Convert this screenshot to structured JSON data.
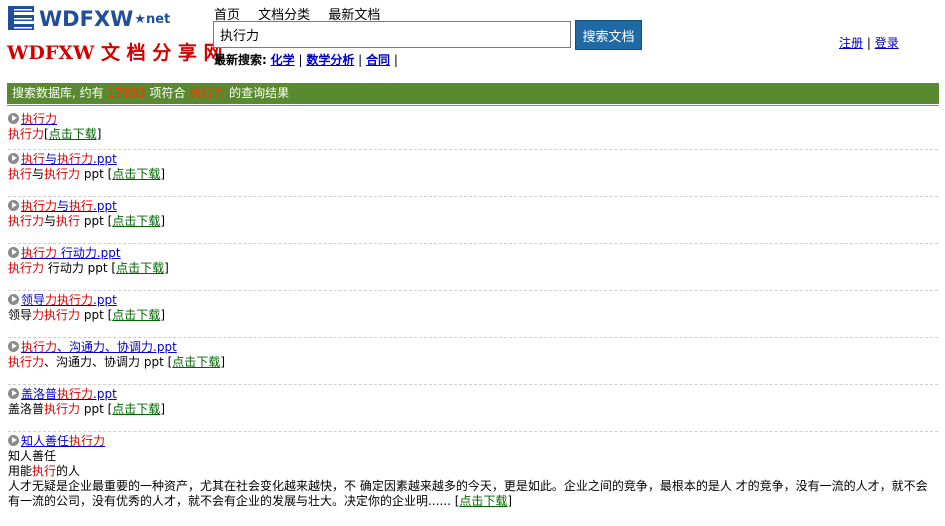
{
  "logo": {
    "wordmark": "WDFXW",
    "net": "★net",
    "subtitle": "WDFXW 文 档 分 享 网"
  },
  "nav": [
    "首页",
    "文档分类",
    "最新文档"
  ],
  "search": {
    "value": "执行力",
    "button": "搜索文档"
  },
  "recent": {
    "label": "最新搜索:",
    "items": [
      "化学",
      "数学分析",
      "合同"
    ]
  },
  "auth": {
    "register": "注册",
    "sep": "|",
    "login": "登录"
  },
  "banner": {
    "prefix": "搜索数据库, 约有 ",
    "count": "17893",
    "middle": " 项符合 ",
    "query": "执行力",
    "suffix": " 的查询结果"
  },
  "download_label": "点击下载",
  "results": [
    {
      "title": [
        "执行力"
      ],
      "desc": [
        "执行力",
        " "
      ]
    },
    {
      "title": [
        "执行",
        "与",
        "执行力",
        ".ppt"
      ],
      "desc": [
        "执行",
        "与",
        "执行力",
        " ppt "
      ]
    },
    {
      "title": [
        "执行力",
        "与",
        "执行",
        ".ppt"
      ],
      "desc": [
        "执行力",
        "与",
        "执行",
        " ppt "
      ]
    },
    {
      "title": [
        "执行力",
        " 行动力",
        ".ppt"
      ],
      "desc": [
        "执行力",
        " 行动力",
        " ppt "
      ]
    },
    {
      "title": [
        "领导",
        "力执行力",
        ".ppt"
      ],
      "desc": [
        "领导",
        "力执行力",
        " ppt "
      ]
    },
    {
      "title": [
        "执行力",
        "、沟通力、协调力",
        ".ppt"
      ],
      "desc": [
        "执行力",
        "、沟通力、协调力",
        " ppt "
      ]
    },
    {
      "title": [
        "盖洛普",
        "执行力",
        ".ppt"
      ],
      "desc": [
        "盖洛普",
        "执行力",
        " ppt "
      ]
    }
  ],
  "last": {
    "title_a": "知人善任",
    "title_b": "执行力",
    "line1": "知人善任",
    "line2_a": "用能",
    "line2_b": "执行",
    "line2_c": "的人",
    "para": "人才无疑是企业最重要的一种资产，尤其在社会变化越来越快，不 确定因素越来越多的今天，更是如此。企业之间的竞争，最根本的是人 才的竞争，没有一流的人才，就不会有一流的公司，没有优秀的人才，就不会有企业的发展与壮大。决定你的企业明......"
  }
}
